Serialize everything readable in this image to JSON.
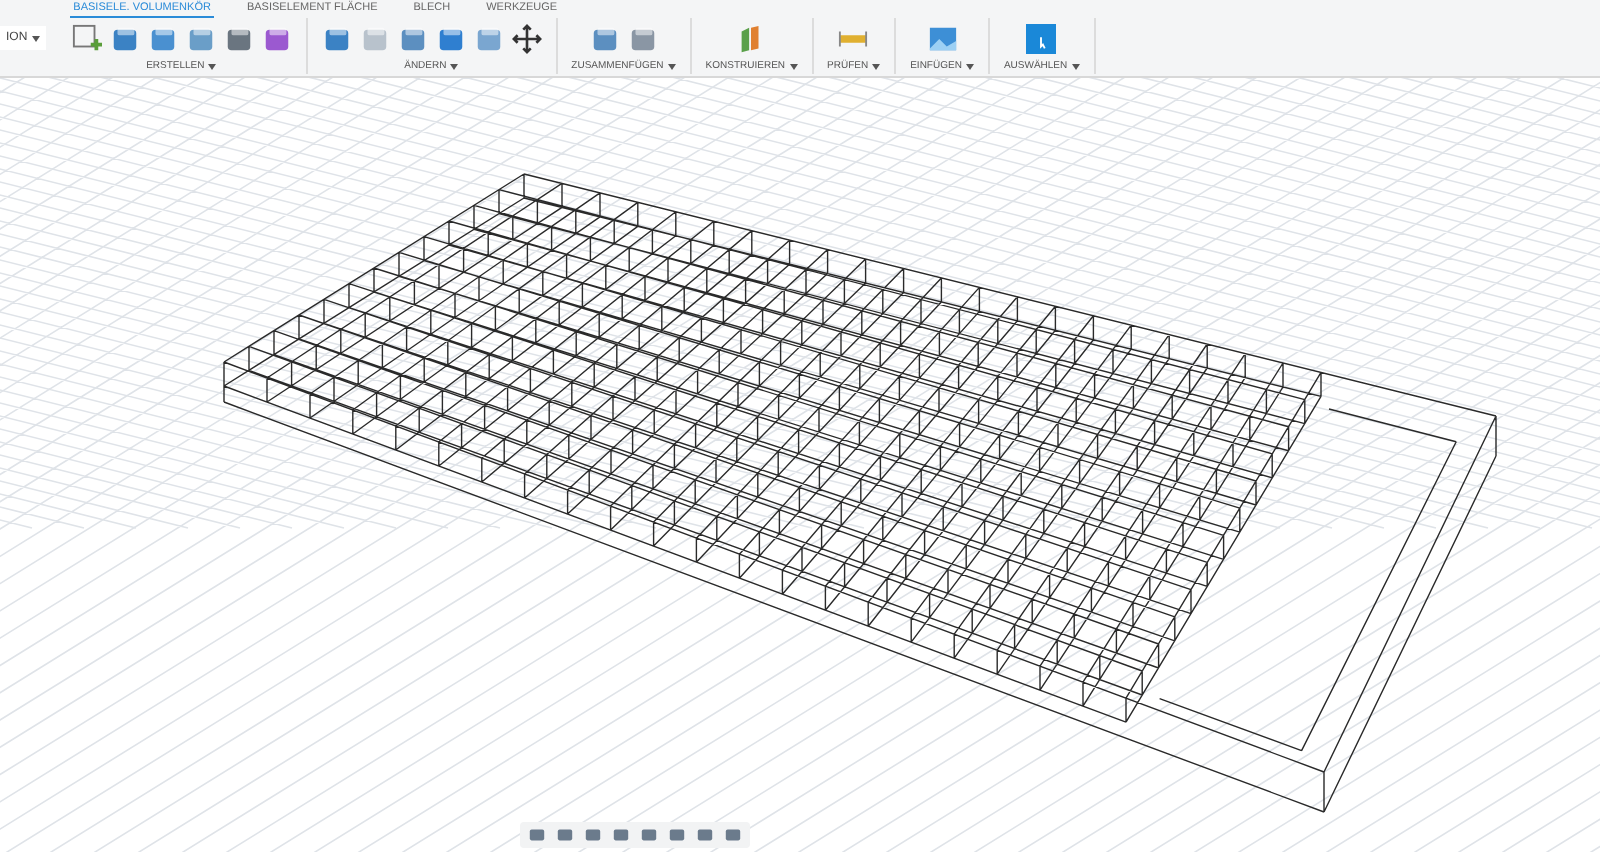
{
  "workspace": {
    "label": "ION"
  },
  "tabs": [
    {
      "label": "BASISELE. VOLUMENKÖR",
      "selected": true
    },
    {
      "label": "BASISELEMENT FLÄCHE",
      "selected": false
    },
    {
      "label": "BLECH",
      "selected": false
    },
    {
      "label": "WERKZEUGE",
      "selected": false
    }
  ],
  "groups": [
    {
      "label": "ERSTELLEN"
    },
    {
      "label": "ÄNDERN"
    },
    {
      "label": "ZUSAMMENFÜGEN"
    },
    {
      "label": "KONSTRUIEREN"
    },
    {
      "label": "PRÜFEN"
    },
    {
      "label": "EINFÜGEN"
    },
    {
      "label": "AUSWÄHLEN"
    }
  ]
}
